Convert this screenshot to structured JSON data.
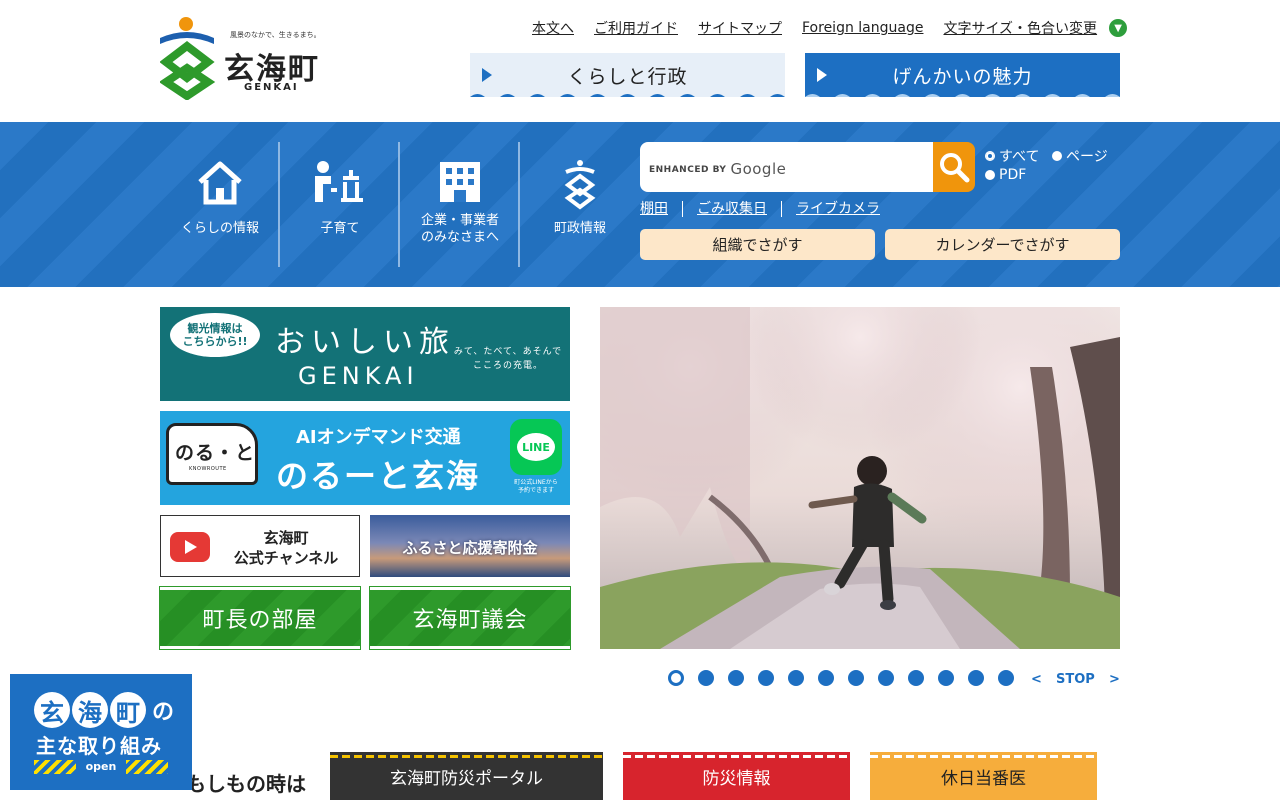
{
  "header": {
    "tagline": "風景のなかで、生きるまち。",
    "logo_name": "玄海町",
    "logo_sub": "GENKAI",
    "utility_links": [
      "本文へ",
      "ご利用ガイド",
      "サイトマップ",
      "Foreign language",
      "文字サイズ・色合い変更"
    ],
    "tabs": {
      "kurashi": "くらしと行政",
      "miryoku": "げんかいの魅力"
    }
  },
  "nav": {
    "items": [
      "くらしの情報",
      "子育て",
      "企業・事業者\nのみなさまへ",
      "町政情報"
    ]
  },
  "search": {
    "brand_prefix": "ENHANCED BY",
    "brand_name": "Google",
    "options": [
      "すべて",
      "ページ",
      "PDF"
    ]
  },
  "quick_links": [
    "棚田",
    "ごみ収集日",
    "ライブカメラ"
  ],
  "find_buttons": {
    "soshiki": "組織でさがす",
    "calendar": "カレンダーでさがす"
  },
  "banners": {
    "oishii": {
      "bubble": "観光情報は\nこちらから!!",
      "title": "おいしい旅",
      "sub": "GENKAI",
      "copy": "みて、たべて、あそんで\nこころの充電。"
    },
    "noroute": {
      "bus_name": "のる・と",
      "bus_sub": "KNOWROUTE",
      "line1": "AIオンデマンド交通",
      "line2": "のるーと玄海",
      "line_icon": "LINE",
      "line_note": "町公式LINEから\n予約できます"
    },
    "youtube": {
      "label": "玄海町\n公式チャンネル"
    },
    "furusato": {
      "label": "ふるさと応援寄附金"
    },
    "chocho": {
      "label": "町長の部屋"
    },
    "gikai": {
      "label": "玄海町議会"
    }
  },
  "slideshow": {
    "dot_count": 12,
    "active_index": 0,
    "prev": "<",
    "stop": "STOP",
    "next": ">"
  },
  "emergency": {
    "title": "もしもの時は",
    "buttons": {
      "portal": "玄海町防災ポータル",
      "bousai": "防災情報",
      "kyujitsu": "休日当番医"
    }
  },
  "float_panel": {
    "circles": [
      "玄",
      "海",
      "町"
    ],
    "no": "の",
    "line2": "主な取り組み",
    "open": "open"
  },
  "colors": {
    "primary_blue": "#1d6fc2",
    "orange": "#f0950c",
    "green": "#2e9a2b",
    "red": "#d7242d"
  }
}
